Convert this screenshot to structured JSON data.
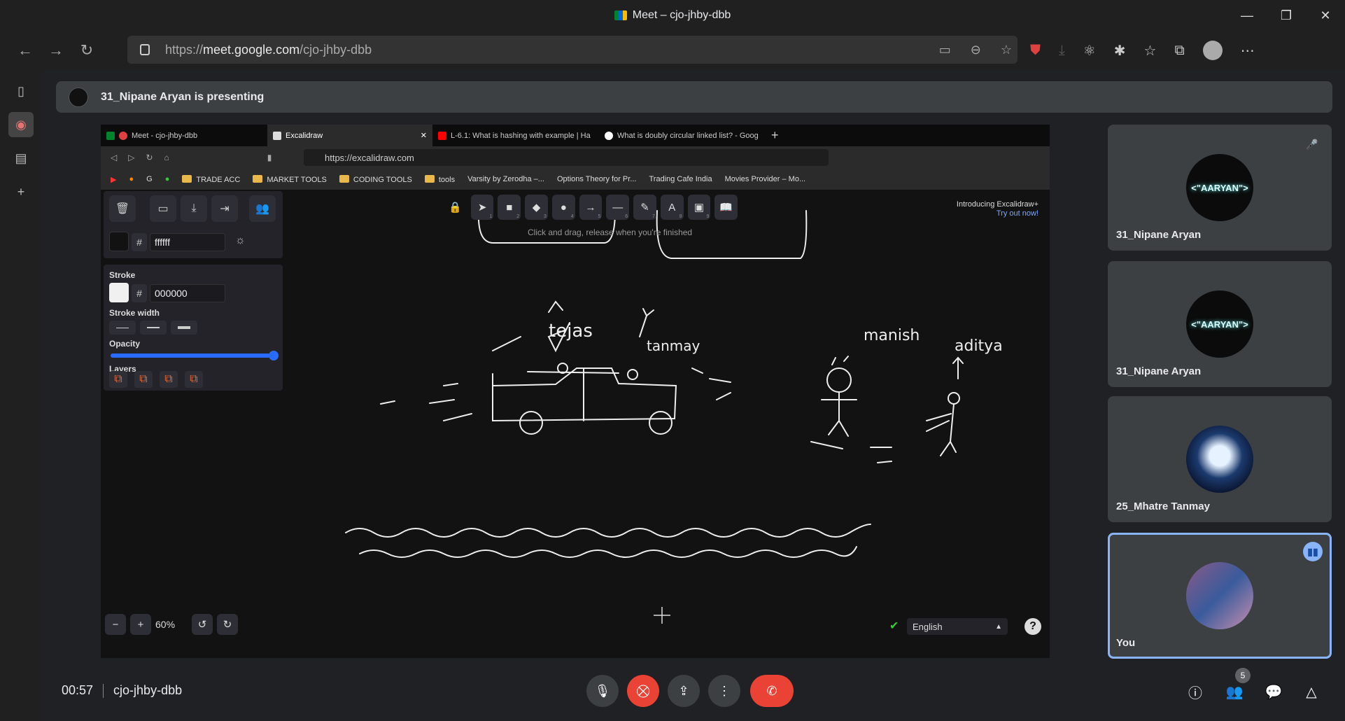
{
  "window": {
    "title": "Meet – cjo-jhby-dbb"
  },
  "edge": {
    "url_prefix": "https://",
    "url_domain": "meet.google.com",
    "url_path": "/cjo-jhby-dbb"
  },
  "presenting_banner": "31_Nipane Aryan is presenting",
  "shared": {
    "tabs": [
      {
        "label": "Meet - cjo-jhby-dbb"
      },
      {
        "label": "Excalidraw"
      },
      {
        "label": "L-6.1: What is hashing with example | Ha"
      },
      {
        "label": "What is doubly circular linked list? - Goog"
      }
    ],
    "url": "https://excalidraw.com",
    "bookmarks": [
      "TRADE ACC",
      "MARKET TOOLS",
      "CODING TOOLS",
      "tools",
      "Varsity by Zerodha –...",
      "Options Theory for Pr...",
      "Trading Cafe India",
      "Movies Provider – Mo..."
    ],
    "excalidraw": {
      "bg_hex": "ffffff",
      "stroke_label": "Stroke",
      "stroke_hex": "000000",
      "stroke_width_label": "Stroke width",
      "opacity_label": "Opacity",
      "opacity_value": 1.0,
      "layers_label": "Layers",
      "hint": "Click and drag, release when you're finished",
      "promo_line1": "Introducing Excalidraw+",
      "promo_line2": "Try out now!",
      "zoom": "60%",
      "language": "English",
      "tool_numbers": [
        "1",
        "2",
        "3",
        "4",
        "5",
        "6",
        "7",
        "8",
        "9"
      ],
      "drawing_labels": [
        "tejas",
        "tanmay",
        "manish",
        "aditya"
      ]
    }
  },
  "participants": [
    {
      "name": "31_Nipane Aryan",
      "avatar_text": "<\"AARYAN\">"
    },
    {
      "name": "31_Nipane Aryan",
      "avatar_text": "<\"AARYAN\">"
    },
    {
      "name": "25_Mhatre Tanmay"
    },
    {
      "name": "You"
    }
  ],
  "meeting": {
    "time": "00:57",
    "code": "cjo-jhby-dbb",
    "people_count": "5"
  }
}
